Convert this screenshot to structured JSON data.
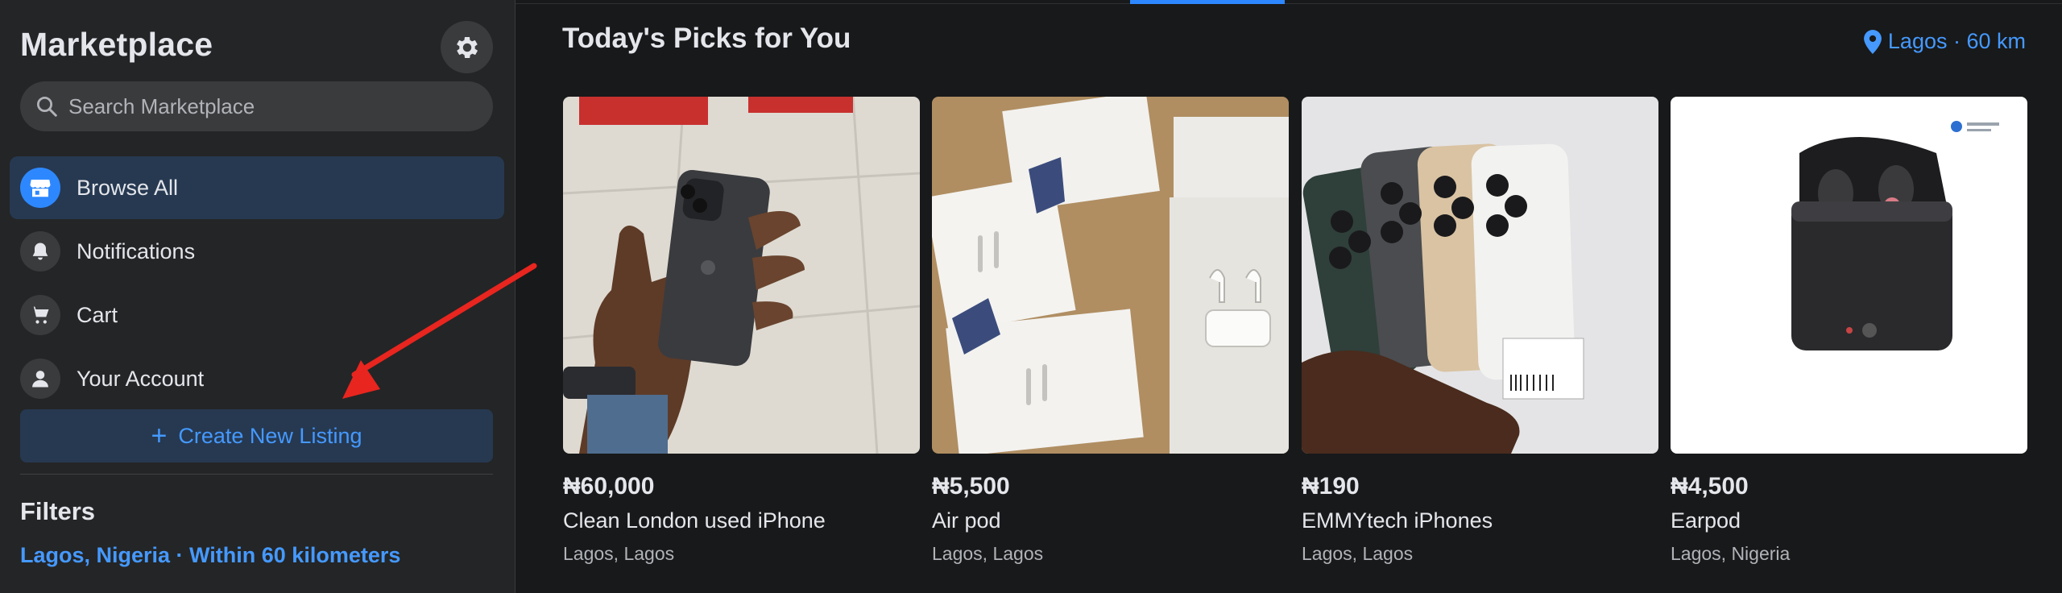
{
  "sidebar": {
    "title": "Marketplace",
    "search_placeholder": "Search Marketplace",
    "nav": [
      {
        "label": "Browse All",
        "icon": "storefront-icon",
        "active": true
      },
      {
        "label": "Notifications",
        "icon": "bell-icon",
        "active": false
      },
      {
        "label": "Cart",
        "icon": "cart-icon",
        "active": false
      },
      {
        "label": "Your Account",
        "icon": "person-icon",
        "active": false
      }
    ],
    "create_button": "Create New Listing",
    "filters_title": "Filters",
    "filters_location": "Lagos, Nigeria · Within 60 kilometers"
  },
  "main": {
    "title": "Today's Picks for You",
    "location": "Lagos · 60 km",
    "listings": [
      {
        "price": "₦60,000",
        "title": "Clean London used iPhone",
        "location": "Lagos, Lagos",
        "image": "iphone-in-hand-photo"
      },
      {
        "price": "₦5,500",
        "title": "Air pod",
        "location": "Lagos, Lagos",
        "image": "airpods-boxes-photo"
      },
      {
        "price": "₦190",
        "title": "EMMYtech iPhones",
        "location": "Lagos, Lagos",
        "image": "iphones-fanned-photo"
      },
      {
        "price": "₦4,500",
        "title": "Earpod",
        "location": "Lagos, Nigeria",
        "image": "earbuds-case-photo"
      }
    ]
  },
  "colors": {
    "background": "#18191a",
    "sidebar": "#242526",
    "accent": "#2d88ff",
    "link": "#4599ff",
    "annotation_arrow": "#e8251f"
  }
}
